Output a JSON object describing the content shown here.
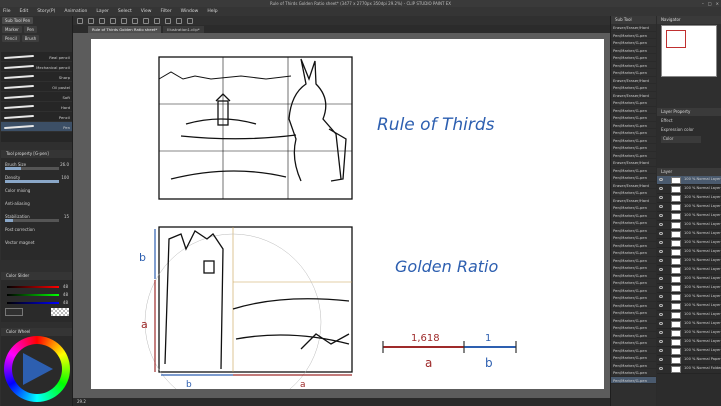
{
  "window": {
    "title": "Rule of Thirds Golden Ratio sheet* (3477 x 2770px 350dpi 29.2%) - CLIP STUDIO PAINT EX",
    "controls": [
      "–",
      "□",
      "×"
    ]
  },
  "menu": [
    "File",
    "Edit",
    "Story(P)",
    "Animation",
    "Layer",
    "Select",
    "View",
    "Filter",
    "Window",
    "Help"
  ],
  "left_panel": {
    "tabs": [
      "Sub Tool Pen",
      "Marker",
      "Pen"
    ],
    "subtabs": [
      "Pencil",
      "Brush"
    ],
    "brushes": [
      {
        "name": "Real pencil"
      },
      {
        "name": "Mechanical pencil"
      },
      {
        "name": "Sharp"
      },
      {
        "name": "Oil pastel"
      },
      {
        "name": "Soft"
      },
      {
        "name": "Hard"
      },
      {
        "name": "Pencil"
      },
      {
        "name": "Pen"
      }
    ],
    "tool_property": {
      "header": "Tool property [G-pen]",
      "rows": [
        {
          "label": "Brush Size",
          "value": "26.0",
          "level": 0.3
        },
        {
          "label": "Density",
          "value": "100",
          "level": 1.0
        },
        {
          "label": "Color mixing",
          "value": "",
          "level": 0
        },
        {
          "label": "Anti-aliasing",
          "value": "",
          "level": 0
        },
        {
          "label": "Stabilization",
          "value": "15",
          "level": 0.15
        },
        {
          "label": "Post correction",
          "value": "",
          "level": 0
        },
        {
          "label": "Vector magnet",
          "value": "",
          "level": 0
        }
      ]
    },
    "color_slider": {
      "header": "Color Slider",
      "values": [
        "48",
        "48",
        "48"
      ]
    },
    "color_wheel": {
      "header": "Color Wheel"
    }
  },
  "canvas_tabs": [
    "Rule of Thirds Golden Ratio sheet*",
    "Illustration1.clip*"
  ],
  "canvas": {
    "rule_of_thirds": "Rule of Thirds",
    "golden_ratio": "Golden Ratio",
    "label_b": "b",
    "label_a": "a",
    "ratio_a": "1,618",
    "ratio_b": "1"
  },
  "sub_tool_column": {
    "header": "Sub Tool",
    "items": [
      "Eraser/Eraser/Hard",
      "Pen/Marker/G-pen",
      "Pen/Marker/G-pen",
      "Pen/Marker/G-pen",
      "Pen/Marker/G-pen",
      "Pen/Marker/G-pen",
      "Pen/Marker/G-pen",
      "Eraser/Eraser/Hard",
      "Pen/Marker/G-pen",
      "Eraser/Eraser/Hard",
      "Pen/Marker/G-pen",
      "Pen/Marker/G-pen",
      "Pen/Marker/G-pen",
      "Pen/Marker/G-pen",
      "Pen/Marker/G-pen",
      "Pen/Marker/G-pen",
      "Pen/Marker/G-pen",
      "Pen/Marker/G-pen",
      "Eraser/Eraser/Hard",
      "Pen/Marker/G-pen",
      "Pen/Marker/G-pen",
      "Eraser/Eraser/Hard",
      "Pen/Marker/G-pen",
      "Eraser/Eraser/Hard",
      "Pen/Marker/G-pen",
      "Pen/Marker/G-pen",
      "Pen/Marker/G-pen",
      "Pen/Marker/G-pen",
      "Pen/Marker/G-pen",
      "Pen/Marker/G-pen",
      "Pen/Marker/G-pen",
      "Pen/Marker/G-pen",
      "Pen/Marker/G-pen",
      "Pen/Marker/G-pen",
      "Pen/Marker/G-pen",
      "Pen/Marker/G-pen",
      "Pen/Marker/G-pen",
      "Pen/Marker/G-pen",
      "Pen/Marker/G-pen",
      "Pen/Marker/G-pen",
      "Pen/Marker/G-pen",
      "Pen/Marker/G-pen",
      "Pen/Marker/G-pen",
      "Pen/Marker/G-pen",
      "Pen/Marker/G-pen",
      "Pen/Marker/G-pen",
      "Pen/Marker/G-pen",
      "Pen/Marker/G-pen"
    ]
  },
  "navigator": {
    "header": "Navigator"
  },
  "layer_property": {
    "header": "Layer Property",
    "effect": "Effect",
    "expression": "Expression color",
    "color_value": "Color"
  },
  "layers": {
    "header": "Layer",
    "items": [
      "100 % Normal Layer 20",
      "100 % Normal Layer 19",
      "100 % Normal Layer 18",
      "100 % Normal Layer 17",
      "100 % Normal Layer 16",
      "100 % Normal Layer 15",
      "100 % Normal Layer 14",
      "100 % Normal Layer 13",
      "100 % Normal Layer 12",
      "100 % Normal Layer 11",
      "100 % Normal Layer 10",
      "100 % Normal Layer 9",
      "100 % Normal Layer 8",
      "100 % Normal Layer 7",
      "100 % Normal Layer 6",
      "100 % Normal Layer 5",
      "100 % Normal Layer 4",
      "100 % Normal Layer 3",
      "100 % Normal Layer 2",
      "100 % Normal Layer 1",
      "100 % Normal Paper",
      "100 % Normal Folder 1"
    ]
  },
  "status": {
    "zoom": "29.2"
  },
  "colors": {
    "accent_blue": "#2d5fb0",
    "accent_red": "#9e2a2a",
    "selection": "#4a5a6e"
  }
}
